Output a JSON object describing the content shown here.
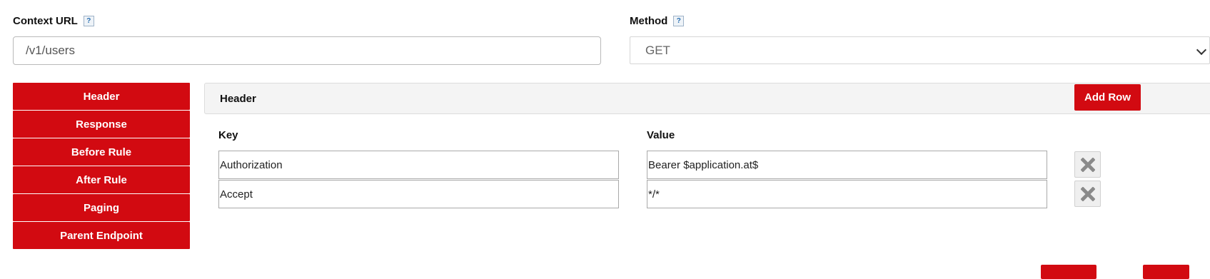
{
  "context_url": {
    "label": "Context URL",
    "help": "?",
    "value": "/v1/users"
  },
  "method": {
    "label": "Method",
    "help": "?",
    "selected": "GET"
  },
  "side_nav": {
    "items": [
      {
        "label": "Header"
      },
      {
        "label": "Response"
      },
      {
        "label": "Before Rule"
      },
      {
        "label": "After Rule"
      },
      {
        "label": "Paging"
      },
      {
        "label": "Parent Endpoint"
      }
    ]
  },
  "header_panel": {
    "title": "Header",
    "add_row_label": "Add Row",
    "columns": {
      "key": "Key",
      "value": "Value"
    },
    "rows": [
      {
        "key": "Authorization",
        "value": "Bearer $application.at$"
      },
      {
        "key": "Accept",
        "value": "*/*"
      }
    ]
  },
  "colors": {
    "accent": "#d20a11"
  }
}
